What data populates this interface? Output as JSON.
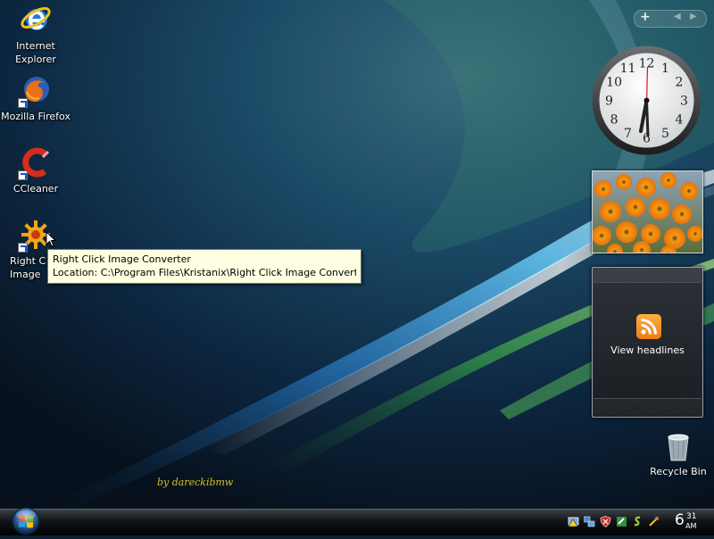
{
  "desktop": {
    "icons": [
      {
        "label_line1": "Internet",
        "label_line2": "Explorer",
        "icon": "internet-explorer-icon"
      },
      {
        "label_line1": "Mozilla Firefox",
        "label_line2": "",
        "icon": "firefox-icon"
      },
      {
        "label_line1": "CCleaner",
        "label_line2": "",
        "icon": "ccleaner-icon"
      },
      {
        "label_line1": "Right C",
        "label_line2": "Image",
        "icon": "image-converter-icon"
      }
    ],
    "tooltip": {
      "title": "Right Click Image Converter",
      "location": "Location: C:\\Program Files\\Kristanix\\Right Click Image Converter"
    },
    "recycle_bin_label": "Recycle Bin",
    "watermark": "by dareckibmw"
  },
  "sidebar": {
    "add_gadget_symbol": "+",
    "clock_numbers": [
      "12",
      "1",
      "2",
      "3",
      "4",
      "5",
      "6",
      "7",
      "8",
      "9",
      "10",
      "11"
    ],
    "feed_label": "View headlines"
  },
  "taskbar": {
    "clock": {
      "hour": "6",
      "minute": "31",
      "ampm": "AM"
    }
  },
  "colors": {
    "tooltip_bg": "#ffffe1",
    "watermark": "#d4c02a",
    "rss": "#f07a12"
  }
}
